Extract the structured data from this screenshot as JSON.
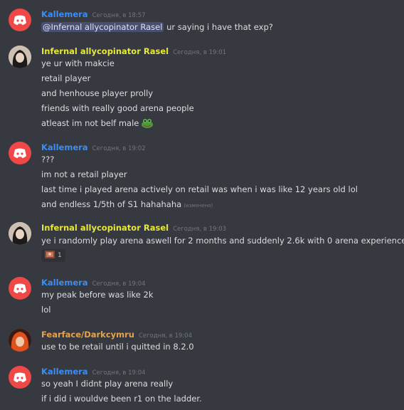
{
  "colors": {
    "background": "#36393f",
    "kallemera": "#3c8ef5",
    "rasel": "#e8e83a",
    "fearface": "#e6a34f",
    "timestamp": "#72767d",
    "text": "#dcddde"
  },
  "messages": [
    {
      "author": "Kallemera",
      "timestamp": "Сегодня, в 18:57",
      "mention": "@Infernal allycopinator Rasel",
      "lines": [
        "ur saying i have that exp?"
      ]
    },
    {
      "author": "Infernal allycopinator Rasel",
      "timestamp": "Сегодня, в 19:01",
      "lines": [
        "ye ur with makcie",
        "retail player",
        "and henhouse player prolly",
        "friends with really good arena people",
        "atleast im not belf male"
      ],
      "emoji": "frog-emoji"
    },
    {
      "author": "Kallemera",
      "timestamp": "Сегодня, в 19:02",
      "lines": [
        "???",
        "im not a retail player",
        "last time i played arena actively on retail was when i was like 12 years old lol",
        "and endless 1/5th of S1 hahahaha"
      ],
      "edited": "(изменено)"
    },
    {
      "author": "Infernal allycopinator Rasel",
      "timestamp": "Сегодня, в 19:03",
      "lines": [
        "ye i randomly play arena aswell for 2 months and suddenly 2.6k with 0 arena experience"
      ],
      "emoji": "astonished-emoji",
      "reaction": {
        "icon": "reaction-image-icon",
        "count": "1"
      }
    },
    {
      "author": "Kallemera",
      "timestamp": "Сегодня, в 19:04",
      "lines": [
        "my peak before was like 2k",
        "lol"
      ]
    },
    {
      "author": "Fearface/Darkcymru",
      "timestamp": "Сегодня, в 19:04",
      "lines": [
        "use to be retail until i quitted in 8.2.0"
      ]
    },
    {
      "author": "Kallemera",
      "timestamp": "Сегодня, в 19:04",
      "lines": [
        "so yeah I didnt play arena really",
        "if i did i wouldve been r1 on the ladder."
      ]
    }
  ]
}
